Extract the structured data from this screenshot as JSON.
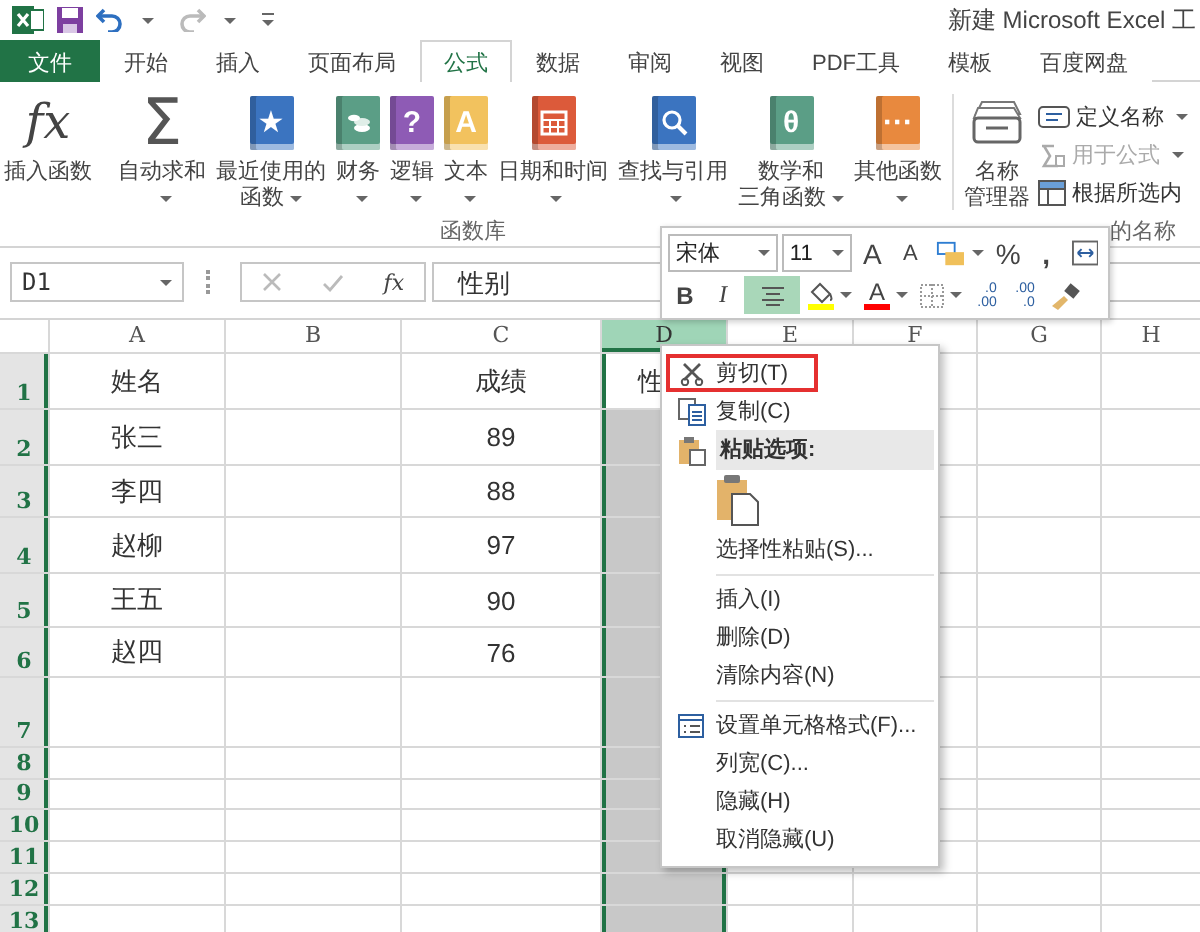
{
  "title_bar": {
    "title": "新建 Microsoft Excel 工"
  },
  "ribbon_tabs": [
    {
      "label": "文件",
      "kind": "file",
      "selected": false
    },
    {
      "label": "开始",
      "kind": "tab",
      "selected": false
    },
    {
      "label": "插入",
      "kind": "tab",
      "selected": false
    },
    {
      "label": "页面布局",
      "kind": "tab",
      "selected": false
    },
    {
      "label": "公式",
      "kind": "tab",
      "selected": true
    },
    {
      "label": "数据",
      "kind": "tab",
      "selected": false
    },
    {
      "label": "审阅",
      "kind": "tab",
      "selected": false
    },
    {
      "label": "视图",
      "kind": "tab",
      "selected": false
    },
    {
      "label": "PDF工具",
      "kind": "tab",
      "selected": false
    },
    {
      "label": "模板",
      "kind": "tab",
      "selected": false
    },
    {
      "label": "百度网盘",
      "kind": "tab",
      "selected": false
    }
  ],
  "ribbon": {
    "function_library": {
      "label": "函数库",
      "buttons": [
        {
          "kind": "fx",
          "glyph": "fx",
          "lines": [
            "插入函数"
          ],
          "dropdown": false
        },
        {
          "kind": "sum",
          "glyph": "Σ",
          "lines": [
            "自动求和"
          ],
          "dropdown": true
        },
        {
          "kind": "glyph-book",
          "glyph": "★",
          "color": "#3b74c0",
          "lines": [
            "最近使用的",
            "函数"
          ],
          "dropdown": true
        },
        {
          "kind": "coins-book",
          "color": "#5b9e86",
          "lines": [
            "财务"
          ],
          "dropdown": true
        },
        {
          "kind": "glyph-book",
          "glyph": "?",
          "color": "#8e5bb5",
          "lines": [
            "逻辑"
          ],
          "dropdown": true
        },
        {
          "kind": "glyph-book",
          "glyph": "A",
          "color": "#f2c25e",
          "lines": [
            "文本"
          ],
          "dropdown": true
        },
        {
          "kind": "calendar-book",
          "color": "#dc5a3a",
          "lines": [
            "日期和时间"
          ],
          "dropdown": true
        },
        {
          "kind": "search-book",
          "color": "#3b74c0",
          "lines": [
            "查找与引用"
          ],
          "dropdown": true
        },
        {
          "kind": "glyph-book",
          "glyph": "θ",
          "color": "#5b9e86",
          "lines": [
            "数学和",
            "三角函数"
          ],
          "dropdown": true
        },
        {
          "kind": "glyph-book",
          "glyph": "···",
          "color": "#e8893e",
          "lines": [
            "其他函数"
          ],
          "dropdown": true
        }
      ]
    },
    "defined_names": {
      "label": "的名称",
      "name_manager": {
        "lines": [
          "名称",
          "管理器"
        ]
      },
      "buttons": [
        {
          "kind": "define",
          "label": "定义名称",
          "dropdown": true,
          "disabled": false
        },
        {
          "kind": "use-in-formula",
          "label": "用于公式",
          "dropdown": true,
          "disabled": true
        },
        {
          "kind": "from-selection",
          "label": "根据所选内",
          "dropdown": false,
          "disabled": false
        }
      ]
    }
  },
  "formula_bar": {
    "name_box": "D1",
    "function_glyph": "fx",
    "formula": "性别"
  },
  "sheet": {
    "columns": [
      {
        "label": "A",
        "selected": false
      },
      {
        "label": "B",
        "selected": false
      },
      {
        "label": "C",
        "selected": false
      },
      {
        "label": "D",
        "selected": true
      },
      {
        "label": "E",
        "selected": false
      },
      {
        "label": "F",
        "selected": false
      },
      {
        "label": "G",
        "selected": false
      },
      {
        "label": "H",
        "selected": false
      }
    ],
    "rows": [
      {
        "header": "1",
        "active": true,
        "cells": [
          "姓名",
          null,
          "成绩",
          "性"
        ]
      },
      {
        "header": "2",
        "active": false,
        "cells": [
          "张三",
          null,
          "89"
        ]
      },
      {
        "header": "3",
        "active": false,
        "cells": [
          "李四",
          null,
          "88"
        ]
      },
      {
        "header": "4",
        "active": false,
        "cells": [
          "赵柳",
          null,
          "97"
        ]
      },
      {
        "header": "5",
        "active": false,
        "cells": [
          "王五",
          null,
          "90"
        ]
      },
      {
        "header": "6",
        "active": false,
        "cells": [
          "赵四",
          null,
          "76"
        ]
      },
      {
        "header": "7",
        "active": false
      },
      {
        "header": "8",
        "active": false
      },
      {
        "header": "9",
        "active": false
      },
      {
        "header": "10",
        "active": false
      },
      {
        "header": "11",
        "active": false
      },
      {
        "header": "12",
        "active": false
      },
      {
        "header": "13",
        "active": false
      }
    ]
  },
  "mini_toolbar": {
    "font": "宋体",
    "size": "11",
    "row_1": [
      {
        "kind": "grow-font",
        "label": "A"
      },
      {
        "kind": "shrink-font",
        "label": "A"
      },
      {
        "kind": "number-format"
      },
      {
        "kind": "percent",
        "label": "%"
      },
      {
        "kind": "comma",
        "label": ","
      },
      {
        "kind": "wrap"
      }
    ],
    "row_2": [
      {
        "kind": "bold",
        "label": "B",
        "selected": false
      },
      {
        "kind": "italic",
        "label": "I",
        "selected": false
      },
      {
        "kind": "align",
        "selected": true
      },
      {
        "kind": "fill-color",
        "color": "#ffff00",
        "selected": false
      },
      {
        "kind": "font-color",
        "label": "A",
        "color": "#ff0000",
        "selected": false
      },
      {
        "kind": "borders",
        "selected": false
      },
      {
        "kind": "increase-decimal",
        "lines": [
          ".0",
          ".00"
        ],
        "selected": false
      },
      {
        "kind": "decrease-decimal",
        "lines": [
          ".00",
          ".0"
        ],
        "selected": false
      },
      {
        "kind": "format-painter",
        "selected": false
      }
    ]
  },
  "context_menu": {
    "items": [
      {
        "kind": "cut",
        "label": "剪切(T)",
        "highlighted": true
      },
      {
        "kind": "copy",
        "label": "复制(C)",
        "highlighted": false
      },
      {
        "kind": "paste-header",
        "label": "粘贴选项:",
        "highlighted": false
      },
      {
        "kind": "paste-option"
      },
      {
        "kind": "item",
        "label": "选择性粘贴(S)...",
        "highlighted": false
      },
      {
        "kind": "separator"
      },
      {
        "kind": "item",
        "label": "插入(I)",
        "highlighted": false
      },
      {
        "kind": "item",
        "label": "删除(D)",
        "highlighted": false
      },
      {
        "kind": "item",
        "label": "清除内容(N)",
        "highlighted": false
      },
      {
        "kind": "separator"
      },
      {
        "kind": "format-cells",
        "label": "设置单元格格式(F)...",
        "highlighted": false
      },
      {
        "kind": "item",
        "label": "列宽(C)...",
        "highlighted": false
      },
      {
        "kind": "item",
        "label": "隐藏(H)",
        "highlighted": false
      },
      {
        "kind": "item",
        "label": "取消隐藏(U)",
        "highlighted": false
      }
    ]
  }
}
